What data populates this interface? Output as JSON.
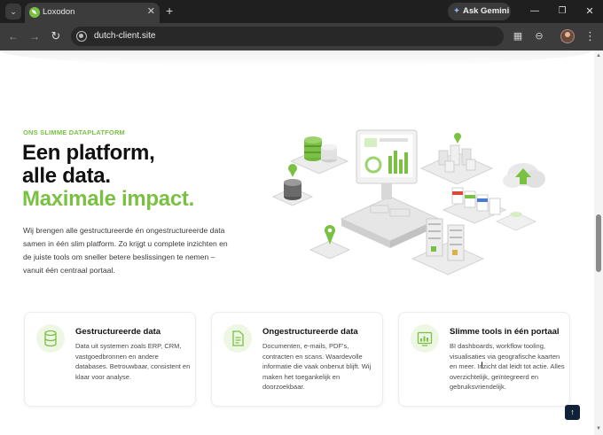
{
  "browser": {
    "tab": {
      "title": "Loxodon",
      "close_glyph": "✕"
    },
    "new_tab_glyph": "+",
    "tab_list_glyph": "⌄",
    "ask_gemini_label": "Ask Gemini",
    "url": "dutch-client.site",
    "window_buttons": {
      "minimize": "—",
      "maximize": "❐",
      "close": "✕"
    },
    "nav": {
      "back": "←",
      "forward": "→",
      "reload": "↻"
    },
    "menu_glyph": "⋮"
  },
  "hero": {
    "eyebrow": "ONS SLIMME DATAPLATFORM",
    "title_line1": "Een platform,",
    "title_line2": "alle data.",
    "title_accent": "Maximale impact.",
    "copy": "Wij brengen alle gestructureerde én ongestructureerde data samen in één slim platform. Zo krijgt u complete inzichten en de juiste tools om sneller betere beslissingen te nemen – vanuit één centraal portaal."
  },
  "cards": [
    {
      "title": "Gestructureerde data",
      "text": "Data uit systemen zoals ERP, CRM, vastgoedbronnen en andere databases. Betrouwbaar, consistent en klaar voor analyse.",
      "icon": "database-icon"
    },
    {
      "title": "Ongestructureerde data",
      "text": "Documenten, e-mails, PDF's, contracten en scans. Waardevolle informatie die vaak onbenut blijft. Wij maken het toegankelijk en doorzoekbaar.",
      "icon": "document-icon"
    },
    {
      "title": "Slimme tools in één portaal",
      "text": "BI dashboards, workflow tooling, visualisaties via geografische kaarten en meer. Inzicht dat leidt tot actie. Alles overzichtelijk, geïntegreerd en gebruiksvriendelijk.",
      "icon": "dashboard-icon"
    }
  ],
  "back_to_top_glyph": "↑",
  "colors": {
    "accent_green": "#7ac143",
    "heading": "#111111",
    "chrome_dark": "#1f1f1f",
    "back_to_top": "#0f2238"
  }
}
